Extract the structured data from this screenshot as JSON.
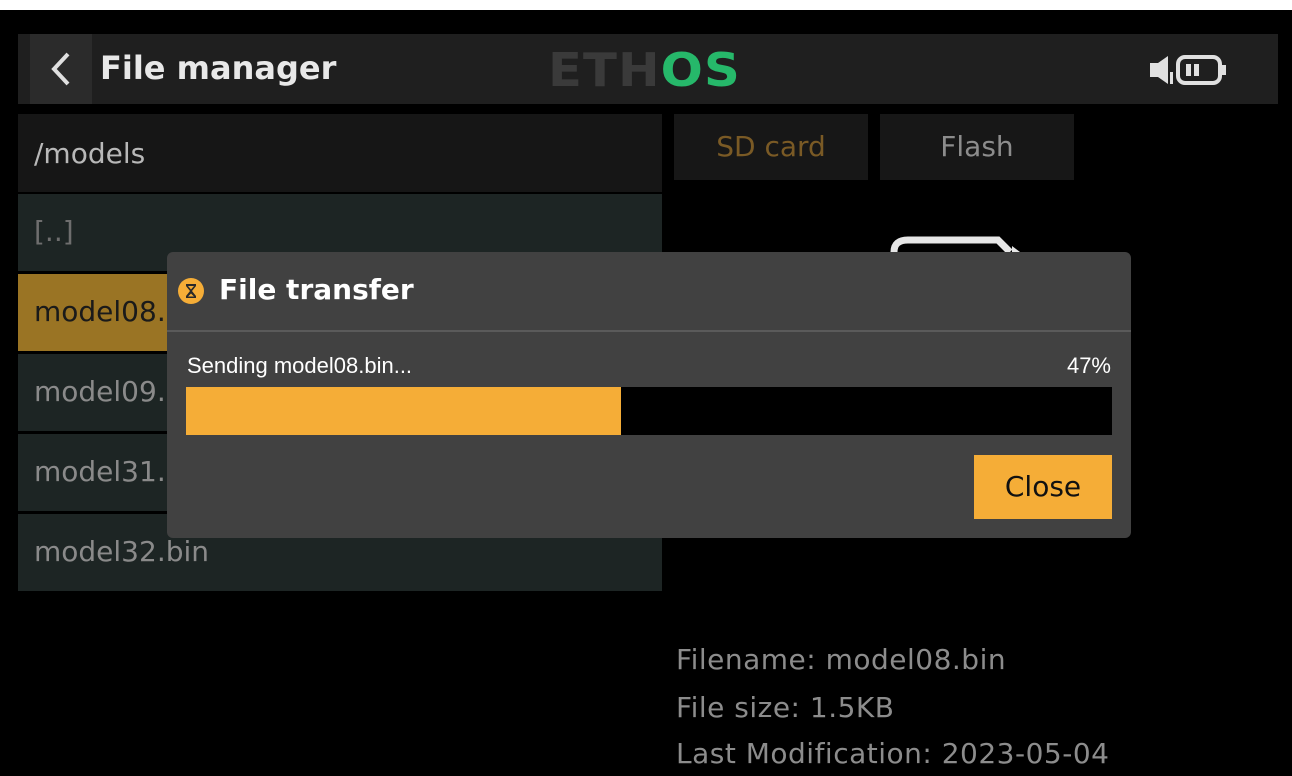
{
  "header": {
    "title": "File manager",
    "logo_left": "ETH",
    "logo_right": "OS"
  },
  "browser": {
    "path": "/models",
    "items": [
      {
        "label": "[..]"
      },
      {
        "label": "model08.bin"
      },
      {
        "label": "model09.bin"
      },
      {
        "label": "model31.bin"
      },
      {
        "label": "model32.bin"
      }
    ]
  },
  "storage_tabs": {
    "sd_card": "SD card",
    "flash": "Flash"
  },
  "file_info": {
    "filename": "Filename: model08.bin",
    "size": "File size: 1.5KB",
    "modified": "Last Modification: 2023-05-04"
  },
  "dialog": {
    "title": "File transfer",
    "status": "Sending model08.bin...",
    "percent_label": "47%",
    "progress": 0.47,
    "close_label": "Close"
  },
  "colors": {
    "accent": "#f5ad37",
    "selected_row": "#9a7424",
    "logo_green": "#26b86a",
    "dialog_bg": "#414141"
  },
  "icons": {
    "back": "chevron-left-icon",
    "speaker": "speaker-icon",
    "battery": "battery-icon",
    "dialog": "hourglass-icon",
    "file": "file-icon"
  }
}
